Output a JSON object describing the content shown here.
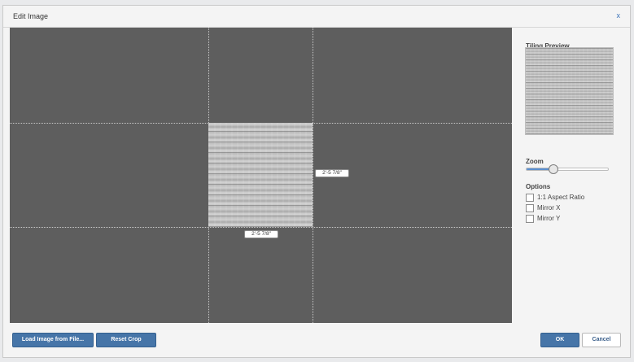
{
  "dialog": {
    "title": "Edit Image",
    "close_label": "x"
  },
  "canvas": {
    "width_label": "2'-5 7/8\"",
    "height_label": "2'-5 7/8\""
  },
  "sidebar": {
    "tiling_preview_label": "Tiling Preview",
    "zoom_label": "Zoom",
    "zoom_value": 0.32,
    "options_label": "Options",
    "options": [
      {
        "label": "1:1 Aspect Ratio",
        "checked": false
      },
      {
        "label": "Mirror X",
        "checked": false
      },
      {
        "label": "Mirror Y",
        "checked": false
      }
    ]
  },
  "footer": {
    "load_label": "Load Image from File...",
    "reset_label": "Reset Crop",
    "ok_label": "OK",
    "cancel_label": "Cancel"
  },
  "colors": {
    "accent": "#4675a8",
    "canvas_bg": "#5e5e5e",
    "link": "#3b73b9"
  }
}
